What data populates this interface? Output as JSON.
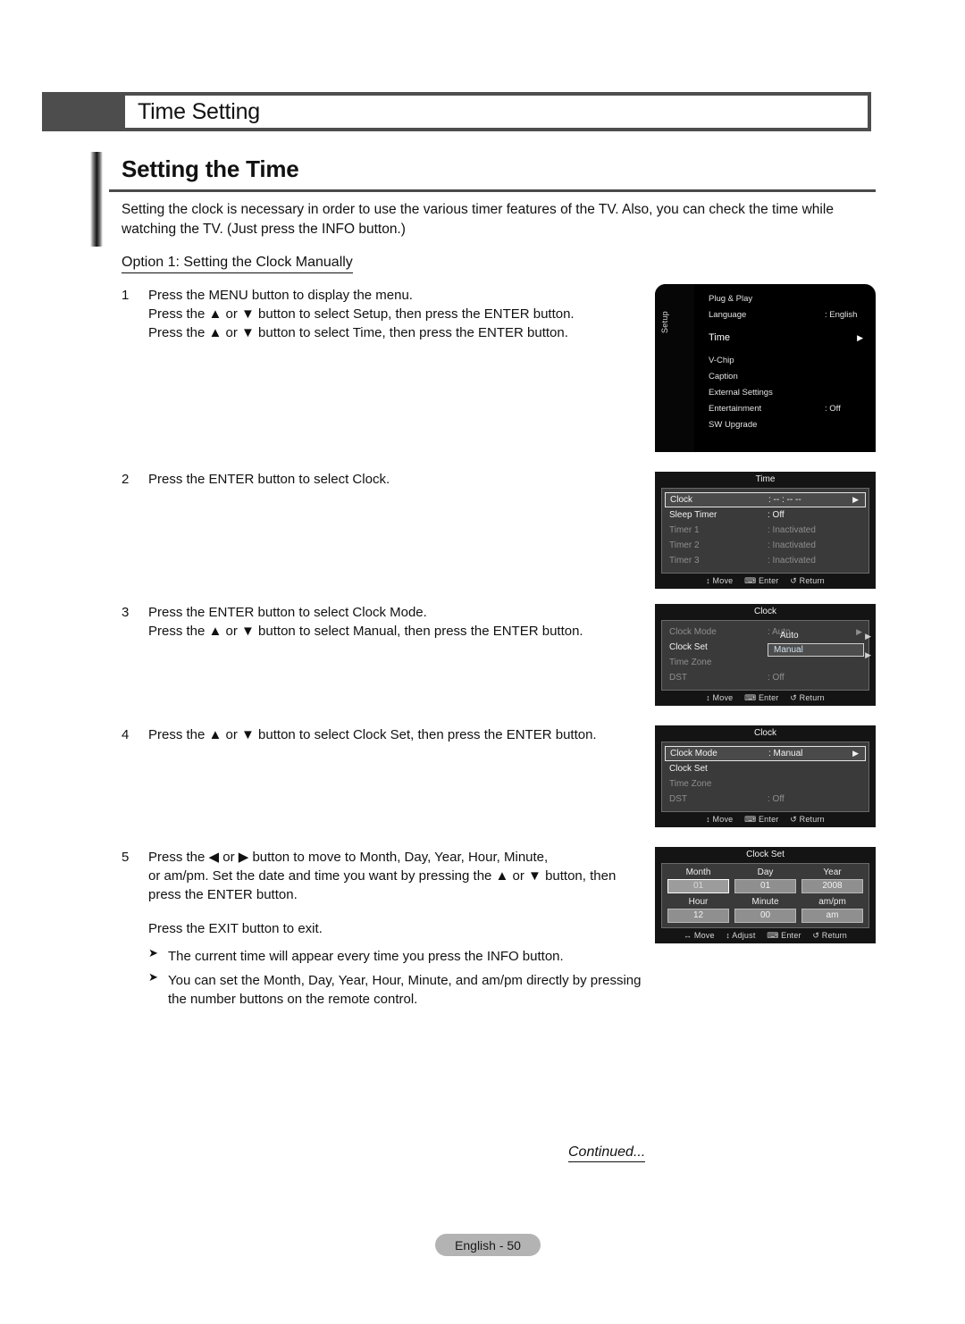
{
  "header": {
    "title": "Time Setting"
  },
  "section": {
    "heading": "Setting the Time",
    "intro": "Setting the clock is necessary in order to use the various timer features of the TV. Also, you can check the time while watching the TV. (Just press the INFO button.)",
    "option_label": "Option 1: Setting the Clock Manually"
  },
  "steps": [
    {
      "num": "1",
      "lines": [
        "Press the MENU button to display the menu.",
        "Press the ▲ or ▼ button to select Setup, then press the ENTER button.",
        "Press the ▲ or ▼ button to select Time, then press the ENTER button."
      ]
    },
    {
      "num": "2",
      "lines": [
        "Press the ENTER button to select Clock."
      ]
    },
    {
      "num": "3",
      "lines": [
        "Press the ENTER button to select Clock Mode.",
        "Press the ▲ or ▼ button to select Manual, then press the ENTER button."
      ]
    },
    {
      "num": "4",
      "lines": [
        "Press the ▲ or ▼ button to select Clock Set, then press the ENTER button."
      ]
    },
    {
      "num": "5",
      "lines": [
        "Press the ◀ or ▶ button to move to Month, Day, Year, Hour, Minute,",
        "or am/pm. Set the date and time you want by pressing the ▲ or ▼ button, then",
        "press the ENTER button."
      ],
      "sub_paragraph": "Press the EXIT button to exit.",
      "bullets": [
        "The current time will appear every time you press the INFO button.",
        "You can set the Month, Day, Year, Hour, Minute, and am/pm directly by pressing the number buttons on the remote control."
      ]
    }
  ],
  "osd": {
    "setup_menu": {
      "rail_label": "Setup",
      "rows": [
        {
          "label": "Plug & Play",
          "value": ""
        },
        {
          "label": "Language",
          "value": ": English"
        },
        {
          "label": "Time",
          "value": "",
          "caret": "▶",
          "highlight": true
        },
        {
          "label": "V-Chip",
          "value": ""
        },
        {
          "label": "Caption",
          "value": ""
        },
        {
          "label": "External Settings",
          "value": ""
        },
        {
          "label": "Entertainment",
          "value": ": Off"
        },
        {
          "label": "SW Upgrade",
          "value": ""
        }
      ]
    },
    "time_menu": {
      "title": "Time",
      "items": [
        {
          "label": "Clock",
          "value": ": -- : -- --",
          "caret": "▶",
          "selected": true
        },
        {
          "label": "Sleep Timer",
          "value": ": Off"
        },
        {
          "label": "Timer 1",
          "value": ": Inactivated",
          "dim": true
        },
        {
          "label": "Timer 2",
          "value": ": Inactivated",
          "dim": true
        },
        {
          "label": "Timer 3",
          "value": ": Inactivated",
          "dim": true
        }
      ],
      "footer": [
        "↕ Move",
        "⌨ Enter",
        "↺ Return"
      ]
    },
    "clock_menu_auto": {
      "title": "Clock",
      "items": [
        {
          "label": "Clock Mode",
          "value": ": Auto",
          "caret": "▶",
          "dim": true
        },
        {
          "label": "Clock Set",
          "value": ""
        },
        {
          "label": "Time Zone",
          "value": "",
          "dim": true
        },
        {
          "label": "DST",
          "value": ": Off",
          "dim": true
        }
      ],
      "dropdown": {
        "option_auto": "Auto",
        "option_manual": "Manual"
      },
      "footer": [
        "↕ Move",
        "⌨ Enter",
        "↺ Return"
      ]
    },
    "clock_menu_manual": {
      "title": "Clock",
      "items": [
        {
          "label": "Clock Mode",
          "value": ": Manual",
          "caret": "▶",
          "selected": true
        },
        {
          "label": "Clock Set",
          "value": ""
        },
        {
          "label": "Time Zone",
          "value": "",
          "dim": true
        },
        {
          "label": "DST",
          "value": ": Off",
          "dim": true
        }
      ],
      "footer": [
        "↕ Move",
        "⌨ Enter",
        "↺ Return"
      ]
    },
    "clock_set": {
      "title": "Clock Set",
      "row1": [
        {
          "label": "Month",
          "value": "01",
          "active": true
        },
        {
          "label": "Day",
          "value": "01"
        },
        {
          "label": "Year",
          "value": "2008"
        }
      ],
      "row2": [
        {
          "label": "Hour",
          "value": "12"
        },
        {
          "label": "Minute",
          "value": "00"
        },
        {
          "label": "am/pm",
          "value": "am"
        }
      ],
      "footer": [
        "↔ Move",
        "↕ Adjust",
        "⌨ Enter",
        "↺ Return"
      ]
    }
  },
  "footer": {
    "continued": "Continued...",
    "page_label": "English - 50"
  }
}
